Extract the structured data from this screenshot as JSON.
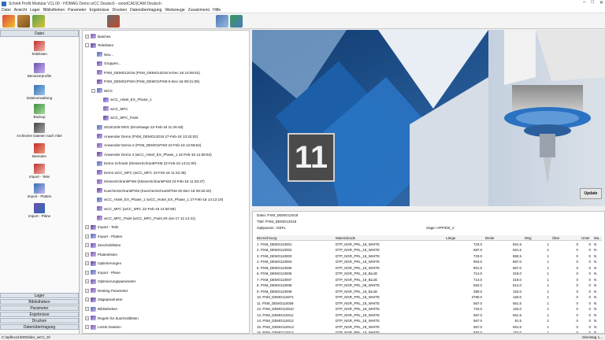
{
  "window": {
    "title": "Schnitt Profit Modular V11.00 - HOMAG Demo wCC Deutsch - woodCAD|CAM Deutsch"
  },
  "menubar": [
    "Datei",
    "Ansicht",
    "Lager",
    "Bibliotheken",
    "Parameter",
    "Ergebnisse",
    "Drucken",
    "Datenübertragung",
    "Werkzeuge",
    "Zusatzmenü",
    "Hilfe"
  ],
  "left_panel": {
    "header": "Datei",
    "items": [
      {
        "label": "Teilelisten",
        "icon": "teilelisten-icon"
      },
      {
        "label": "Benutzerprofile",
        "icon": "benutzerprofile-icon"
      },
      {
        "label": "Dateiverwaltung",
        "icon": "dateiverwaltung-icon"
      },
      {
        "label": "Backup",
        "icon": "backup-icon"
      },
      {
        "label": "Archiviere Dateien nach Alter",
        "icon": "archive-icon"
      },
      {
        "label": "Beenden",
        "icon": "exit-icon"
      },
      {
        "label": "Import - Teile",
        "icon": "import-teile-icon"
      },
      {
        "label": "Import - Platten",
        "icon": "import-platten-icon"
      },
      {
        "label": "Import - Pläne",
        "icon": "import-plaene-icon"
      }
    ],
    "bottom_tabs": [
      "Lager",
      "Bibliotheken",
      "Parameter",
      "Ergebnisse",
      "Drucken",
      "Datenübertragung"
    ]
  },
  "tree": {
    "nodes": [
      {
        "label": "Batches",
        "level": 0,
        "expander": "+"
      },
      {
        "label": "Teilelisten",
        "level": 0,
        "expander": "-"
      },
      {
        "label": "Neu...",
        "level": 1,
        "expander": ""
      },
      {
        "label": "Gruppen...",
        "level": 1,
        "expander": ""
      },
      {
        "label": "PXM_DEMO12018 (PXM_DEMO12018 5-Dec-18 10:06:52)",
        "level": 1,
        "expander": ""
      },
      {
        "label": "PXM_DEMO1PXM (PXM_DEMO1PXM 6-Dec-18 09:21:09)",
        "level": 1,
        "expander": ""
      },
      {
        "label": "WCC",
        "level": 1,
        "expander": "-"
      },
      {
        "label": "wCC_Hotel_EX_Phase_1",
        "level": 2,
        "expander": ""
      },
      {
        "label": "wCC_MFC",
        "level": 2,
        "expander": ""
      },
      {
        "label": "wCC_MFC_Paint",
        "level": 2,
        "expander": ""
      },
      {
        "label": "20181205-0001 (Einzelaage 22-Feb-18 11:26:48)",
        "level": 1,
        "expander": ""
      },
      {
        "label": "Anwender Demo (PXM_DEMO12018 27-Feb-18 13:42:02)",
        "level": 1,
        "expander": ""
      },
      {
        "label": "Anwender-Demo-2 (PXM_DEMO1PXM 22-Feb-18 12:59:52)",
        "level": 1,
        "expander": ""
      },
      {
        "label": "Anwender Demo 3 (wCC_Hotel_EX_Phase_1 22-Feb-18 12:59:53)",
        "level": 1,
        "expander": ""
      },
      {
        "label": "Demo Schrank (KleinerSchrankPXM 22-Feb-18 14:11:00)",
        "level": 1,
        "expander": ""
      },
      {
        "label": "Demo wCC_MFC (wCC_MFC 22-Feb-18 11:42:48)",
        "level": 1,
        "expander": ""
      },
      {
        "label": "KleinerSchrankPXM (KleinerSchrankPXM 22-Feb-18 11:28:37)",
        "level": 1,
        "expander": ""
      },
      {
        "label": "KuechenSchrankPXM (KuechenSchrankPXM 20-Dec-18 09:32:20)",
        "level": 1,
        "expander": ""
      },
      {
        "label": "wCC_Hotel_EX_Phase_1 (wCC_Hotel_EX_Phase_1 27-Feb-18 14:12:19)",
        "level": 1,
        "expander": ""
      },
      {
        "label": "wCC_MFC (wCC_MFC 22-Feb-18 14:50:59)",
        "level": 1,
        "expander": ""
      },
      {
        "label": "wCC_MFC_Paint (wCC_MFC_Paint 20-Jun-17 11:14:41)",
        "level": 1,
        "expander": ""
      },
      {
        "label": "Import - Teile",
        "level": 0,
        "expander": "+"
      },
      {
        "label": "Import - Platten",
        "level": 0,
        "expander": "+"
      },
      {
        "label": "Zuschnittlisten",
        "level": 0,
        "expander": "+"
      },
      {
        "label": "Plattenlisten",
        "level": 0,
        "expander": "+"
      },
      {
        "label": "Optimierungen",
        "level": 0,
        "expander": "+"
      },
      {
        "label": "Import - Pläne",
        "level": 0,
        "expander": "+"
      },
      {
        "label": "Optimierungsparameter",
        "level": 0,
        "expander": "+"
      },
      {
        "label": "Nesting Parameter",
        "level": 0,
        "expander": "+"
      },
      {
        "label": "Sägeparameter",
        "level": 0,
        "expander": "+"
      },
      {
        "label": "Bibliotheken",
        "level": 0,
        "expander": "+"
      },
      {
        "label": "Regeln für Zuschnittlisten",
        "level": 0,
        "expander": "+"
      },
      {
        "label": "Letzte Dateien",
        "level": 0,
        "expander": "+"
      }
    ]
  },
  "banner": {
    "version_text": "11",
    "update_label": "Update"
  },
  "details": {
    "datei": "Datei: PXM_DEMO12018",
    "titel": "Titel: PXM_DEMO12018",
    "optiparam": "Optiparam.: DEFL",
    "saege": "Säge: HPP300_2",
    "columns": [
      "Bezeichnung",
      "Materialcode",
      "Länge",
      "Breite",
      "Mng",
      "Über",
      "Unter",
      "Ma..."
    ],
    "rows": [
      [
        "1. PXM_DEMO110001",
        "DTP_NGR_PRL_18_WHITE",
        "723.0",
        "561.5",
        "1",
        "0",
        "0",
        "N"
      ],
      [
        "2. PXM_DEMO110002",
        "DTP_NGR_PRL_18_WHITE",
        "687.0",
        "561.5",
        "1",
        "0",
        "0",
        "N"
      ],
      [
        "3. PXM_DEMO110003",
        "DTP_NGR_PRL_18_WHITE",
        "723.0",
        "883.5",
        "1",
        "0",
        "0",
        "N"
      ],
      [
        "4. PXM_DEMO110004",
        "DTP_NGR_PRL_18_WHITE",
        "903.0",
        "867.0",
        "1",
        "0",
        "0",
        "N"
      ],
      [
        "5. PXM_DEMO110005",
        "DTP_NGR_PRL_18_WHITE",
        "901.5",
        "867.0",
        "1",
        "0",
        "0",
        "N"
      ],
      [
        "6. PXM_DEMO110006",
        "DTP_NGR_PRL_18_BLUE",
        "714.0",
        "319.0",
        "1",
        "0",
        "0",
        "N"
      ],
      [
        "7. PXM_DEMO110007",
        "DTP_NGR_PRL_18_BLUE",
        "714.0",
        "319.0",
        "1",
        "0",
        "0",
        "N"
      ],
      [
        "8. PXM_DEMO110008",
        "DTP_NGR_PRL_08_WHITE",
        "694.0",
        "814.0",
        "1",
        "0",
        "0",
        "N"
      ],
      [
        "9. PXM_DEMO110009",
        "DTP_NGR_PRL_18_BLUE",
        "380.0",
        "153.0",
        "1",
        "0",
        "0",
        "N"
      ],
      [
        "10. PXM_DEMO110071",
        "DTP_NGR_PRL_18_WHITE",
        "2780.0",
        "153.0",
        "1",
        "0",
        "0",
        "N"
      ],
      [
        "11. PXM_DEMO110008",
        "DTP_NGR_PRL_18_WHITE",
        "567.0",
        "561.5",
        "1",
        "0",
        "0",
        "N"
      ],
      [
        "12. PXM_DEMO110010",
        "DTP_NGR_PRL_18_WHITE",
        "723.0",
        "153.0",
        "1",
        "0",
        "0",
        "N"
      ],
      [
        "13. PXM_DEMO110011",
        "DTP_NGR_PRL_18_WHITE",
        "567.0",
        "561.5",
        "1",
        "0",
        "0",
        "N"
      ],
      [
        "14. PXM_DEMO110012",
        "DTP_NGR_PRL_18_WHITE",
        "567.0",
        "81.5",
        "1",
        "0",
        "0",
        "N"
      ],
      [
        "15. PXM_DEMO110013",
        "DTP_NGR_PRL_18_WHITE",
        "567.0",
        "561.5",
        "1",
        "0",
        "0",
        "N"
      ],
      [
        "16. PXM_DEMO110014",
        "DTP_NGR_PRL_18_WHITE",
        "587.0",
        "153.0",
        "1",
        "0",
        "0",
        "N"
      ]
    ]
  },
  "statusbar": {
    "left": "C:\\spflex11\\MODider_wCC_D\\",
    "right": "Dienstag 1..."
  },
  "colors": {
    "accent": "#2f6fb3",
    "banner_dark": "#173f73",
    "banner_light": "#dfe9f4"
  }
}
